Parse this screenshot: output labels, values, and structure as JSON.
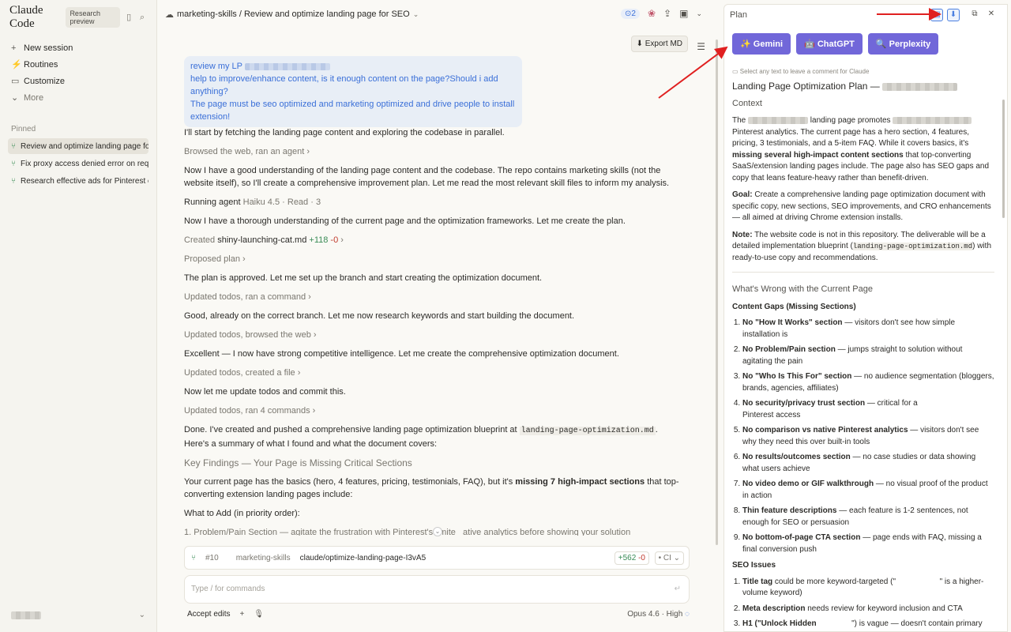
{
  "sidebar": {
    "logo": "Claude Code",
    "badge": "Research preview",
    "nav": [
      {
        "icon": "+",
        "label": "New session"
      },
      {
        "icon": "⚡",
        "label": "Routines"
      },
      {
        "icon": "▭",
        "label": "Customize"
      },
      {
        "icon": "⌄",
        "label": "More"
      }
    ],
    "pinned_heading": "Pinned",
    "pinned": [
      {
        "label": "Review and optimize landing page for"
      },
      {
        "label": "Fix proxy access denied error on requ"
      },
      {
        "label": "Research effective ads for Pinterest e"
      }
    ]
  },
  "topbar": {
    "repo": "marketing-skills",
    "separator": " / ",
    "title": "Review and optimize landing page for SEO",
    "pr_count": "2",
    "export_label": "⬇ Export MD"
  },
  "user_message": {
    "line1": "review my LP",
    "line2": "help to improve/enhance content, is it enough content on the page?Should i add anything?",
    "line3": "The page must be seo optimized and marketing optimized and drive people to install extension!"
  },
  "conversation": {
    "m1": "I'll start by fetching the landing page content and exploring the codebase in parallel.",
    "s1": "Browsed the web, ran an agent ›",
    "m2": "Now I have a good understanding of the landing page content and the codebase. The repo contains marketing skills (not the website itself), so I'll create a comprehensive improvement plan. Let me read the most relevant skill files to inform my analysis.",
    "agent_label": "Running agent",
    "agent_meta": "Haiku 4.5 · Read · 3",
    "m3": "Now I have a thorough understanding of the current page and the optimization frameworks. Let me create the plan.",
    "created_label": "Created",
    "created_file": "shiny-launching-cat.md",
    "created_add": "+118",
    "created_del": "-0",
    "s3": "Proposed plan ›",
    "m4": "The plan is approved. Let me set up the branch and start creating the optimization document.",
    "s4": "Updated todos, ran a command ›",
    "m5": "Good, already on the correct branch. Let me now research keywords and start building the document.",
    "s5": "Updated todos, browsed the web ›",
    "m6": "Excellent — I now have strong competitive intelligence. Let me create the comprehensive optimization document.",
    "s6": "Updated todos, created a file ›",
    "m7": "Now let me update todos and commit this.",
    "s7": "Updated todos, ran 4 commands ›",
    "m8a": "Done. I've created and pushed a comprehensive landing page optimization blueprint at",
    "m8code": "landing-page-optimization.md",
    "m8b": ". Here's a summary of what I found and what the document covers:",
    "h1": "Key Findings — Your Page is Missing Critical Sections",
    "m9a": "Your current page has the basics (hero, 4 features, pricing, testimonials, FAQ), but it's",
    "m9b": "missing 7 high-impact sections",
    "m9c": "that top-converting extension landing pages include:",
    "m10": "What to Add (in priority order):",
    "m11": "1. Problem/Pain Section — agitate the frustration with Pinterest's limite   ative analytics before showing your solution"
  },
  "prbar": {
    "number": "#10",
    "repo": "marketing-skills",
    "branch": "claude/optimize-landing-page-I3vA5",
    "add": "+562",
    "del": "-0",
    "ci": "• CI ⌄"
  },
  "input": {
    "placeholder": "Type / for commands"
  },
  "footer": {
    "mode": "Accept edits",
    "model": "Opus 4.6 · High"
  },
  "plan": {
    "header": "Plan",
    "ai_buttons": [
      {
        "icon": "✨",
        "label": "Gemini"
      },
      {
        "icon": "🤖",
        "label": "ChatGPT"
      },
      {
        "icon": "🔍",
        "label": "Perplexity"
      }
    ],
    "hint": "Select any text to leave a comment for Claude",
    "title": "Landing Page Optimization Plan —",
    "context_heading": "Context",
    "context_a": "The",
    "context_b": "landing page promotes",
    "context_c": "Pinterest analytics. The current page has a hero section, 4 features, pricing, 3 testimonials, and a 5-item FAQ. While it covers basics, it's",
    "context_bold": "missing several high-impact content sections",
    "context_d": "that top-converting SaaS/extension landing pages include. The page also has SEO gaps and copy that leans feature-heavy rather than benefit-driven.",
    "goal_label": "Goal:",
    "goal_text": "Create a comprehensive landing page optimization document with specific copy, new sections, SEO improvements, and CRO enhancements — all aimed at driving Chrome extension installs.",
    "note_label": "Note:",
    "note_a": "The website code is not in this repository. The deliverable will be a detailed implementation blueprint (",
    "note_code": "landing-page-optimization.md",
    "note_b": ") with ready-to-use copy and recommendations.",
    "wrong_heading": "What's Wrong with the Current Page",
    "gaps_heading": "Content Gaps (Missing Sections)",
    "gaps": [
      {
        "b": "No \"How It Works\" section",
        "t": " — visitors don't see how simple installation is"
      },
      {
        "b": "No Problem/Pain section",
        "t": " — jumps straight to solution without agitating the pain"
      },
      {
        "b": "No \"Who Is This For\" section",
        "t": " — no audience segmentation (bloggers, brands, agencies, affiliates)"
      },
      {
        "b": "No security/privacy trust section",
        "t": " — critical for a                         Pinterest access"
      },
      {
        "b": "No comparison vs native Pinterest analytics",
        "t": " — visitors don't see why they need this over built-in tools"
      },
      {
        "b": "No results/outcomes section",
        "t": " — no case studies or data showing what users achieve"
      },
      {
        "b": "No video demo or GIF walkthrough",
        "t": " — no visual proof of the product in action"
      },
      {
        "b": "Thin feature descriptions",
        "t": " — each feature is 1-2 sentences, not enough for SEO or persuasion"
      },
      {
        "b": "No bottom-of-page CTA section",
        "t": " — page ends with FAQ, missing a final conversion push"
      }
    ],
    "seo_heading": "SEO Issues",
    "seo": [
      {
        "b": "Title tag",
        "t": " could be more keyword-targeted (\"                    \" is a higher-volume keyword)"
      },
      {
        "b": "Meta description",
        "t": " needs review for keyword inclusion and CTA"
      },
      {
        "b": "H1 (\"Unlock Hidden",
        "t": "                \") is vague — doesn't contain primary"
      }
    ]
  },
  "colors": {
    "accent": "#7167d9",
    "link": "#3a6fd8",
    "add": "#3a8c56",
    "del": "#c0392b",
    "arrow": "#e02020"
  }
}
